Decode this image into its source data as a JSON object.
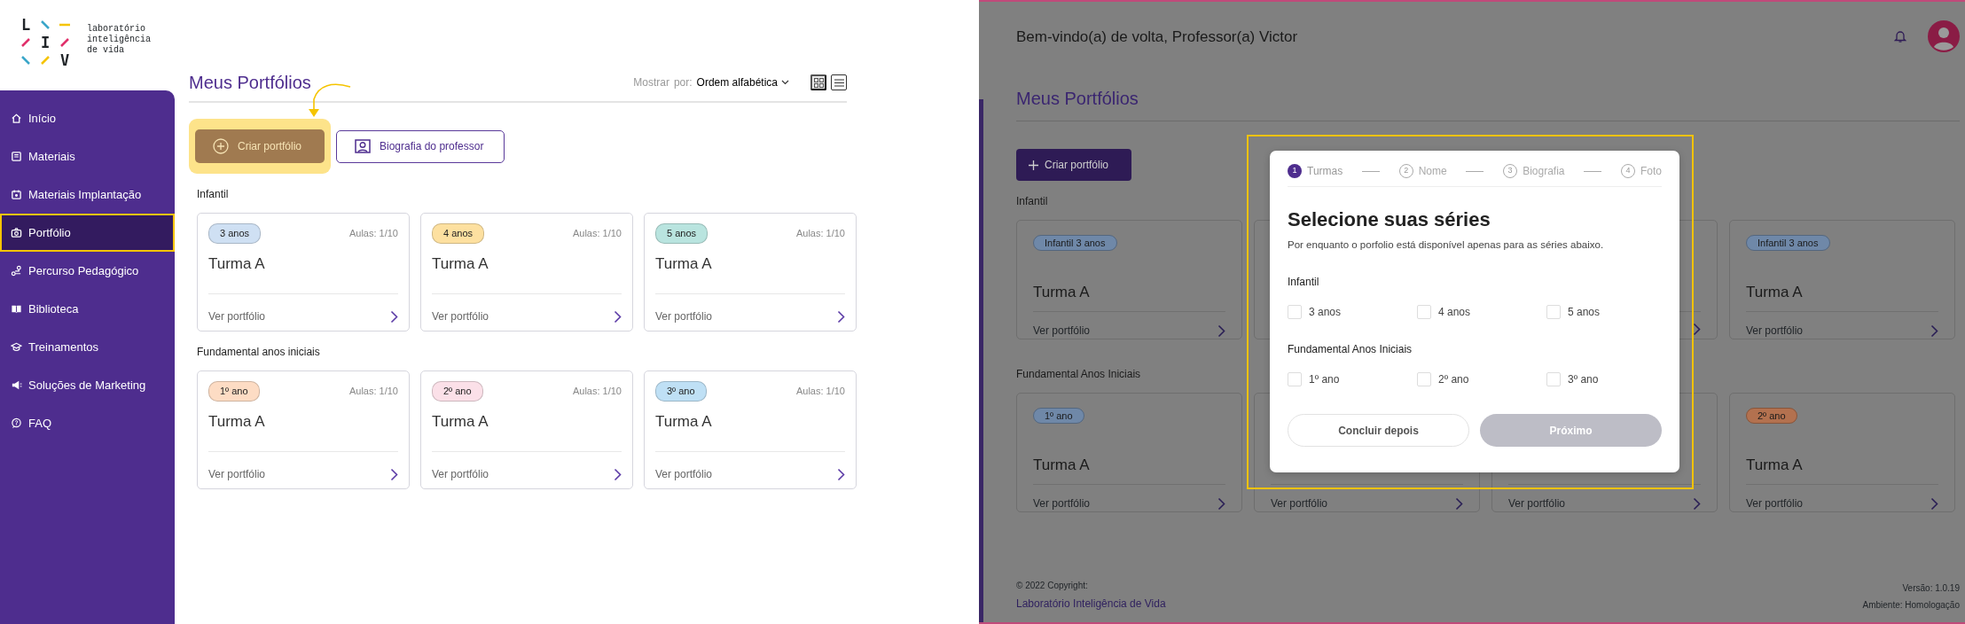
{
  "left_page": {
    "logo": {
      "letters": [
        "L",
        "I",
        "V"
      ],
      "tagline": [
        "laboratório",
        "inteligência",
        "de vida"
      ]
    },
    "sidebar": {
      "items": [
        {
          "label": "Início",
          "selected": false
        },
        {
          "label": "Materiais",
          "selected": false
        },
        {
          "label": "Materiais Implantação",
          "selected": false
        },
        {
          "label": "Portfólio",
          "selected": true
        },
        {
          "label": "Percurso Pedagógico",
          "selected": false
        },
        {
          "label": "Biblioteca",
          "selected": false
        },
        {
          "label": "Treinamentos",
          "selected": false
        },
        {
          "label": "Soluções de Marketing",
          "selected": false
        },
        {
          "label": "FAQ",
          "selected": false
        }
      ]
    },
    "header": {
      "title": "Meus Portfólios",
      "sort_label": "Mostrar",
      "sort_by": "por:",
      "sort_value": "Ordem alfabética",
      "view_modes": [
        {
          "kind": "grid",
          "selected": true
        },
        {
          "kind": "list",
          "selected": false
        }
      ]
    },
    "actions": [
      {
        "kind": "create",
        "label": "Criar portfólio",
        "highlighted": true
      },
      {
        "kind": "bio",
        "label": "Biografia do professor",
        "highlighted": false
      }
    ],
    "sections": [
      {
        "title": "Infantil",
        "cards": [
          {
            "badge": "3 anos",
            "color": "#cfe0f3",
            "lessons": "Aulas: 1/10",
            "title": "Turma A",
            "link": "Ver portfólio"
          },
          {
            "badge": "4 anos",
            "color": "#fde0a0",
            "lessons": "Aulas: 1/10",
            "title": "Turma A",
            "link": "Ver portfólio"
          },
          {
            "badge": "5 anos",
            "color": "#b9e4df",
            "lessons": "Aulas: 1/10",
            "title": "Turma A",
            "link": "Ver portfólio"
          }
        ]
      },
      {
        "title": "Fundamental anos iniciais",
        "cards": [
          {
            "badge": "1º ano",
            "color": "#fddcc4",
            "lessons": "Aulas: 1/10",
            "title": "Turma A",
            "link": "Ver portfólio"
          },
          {
            "badge": "2º ano",
            "color": "#fbe0e8",
            "lessons": "Aulas: 1/10",
            "title": "Turma A",
            "link": "Ver portfólio"
          },
          {
            "badge": "3º ano",
            "color": "#bfe0f5",
            "lessons": "Aulas: 1/10",
            "title": "Turma A",
            "link": "Ver portfólio"
          }
        ]
      }
    ]
  },
  "right_page": {
    "greeting": "Bem-vindo(a) de volta, Professor(a) Victor",
    "title": "Meus Portfólios",
    "create_button": "Criar portfólio",
    "sections": [
      {
        "title": "Infantil",
        "cards": [
          {
            "badge": "Infantil 3 anos",
            "color": "#6f88a8",
            "title": "Turma A",
            "link": "Ver portfólio",
            "chevron": true
          },
          {
            "chevron": false
          },
          {
            "chevron": true
          },
          {
            "badge": "Infantil 3 anos",
            "color": "#6f88a8",
            "title": "Turma A",
            "link": "Ver portfólio",
            "chevron": true
          }
        ]
      },
      {
        "title": "Fundamental Anos Iniciais",
        "cards": [
          {
            "badge": "1º ano",
            "color": "#6f88a8",
            "title": "Turma A",
            "link": "Ver portfólio",
            "chevron": true
          },
          {
            "link": "Ver portfólio",
            "chevron": true
          },
          {
            "link": "Ver portfólio",
            "chevron": true
          },
          {
            "badge": "2º ano",
            "color": "#b3714f",
            "title": "Turma A",
            "link": "Ver portfólio",
            "chevron": true
          }
        ]
      }
    ],
    "footer": {
      "copyright": "© 2022 Copyright:",
      "company": "Laboratório Inteligência de Vida",
      "version": "Versão: 1.0.19",
      "environment": "Ambiente: Homologação"
    },
    "modal": {
      "steps": [
        {
          "number": "1",
          "label": "Turmas",
          "selected": true
        },
        {
          "number": "2",
          "label": "Nome",
          "selected": false
        },
        {
          "number": "3",
          "label": "Biografia",
          "selected": false
        },
        {
          "number": "4",
          "label": "Foto",
          "selected": false
        }
      ],
      "title": "Selecione suas séries",
      "subtitle": "Por enquanto o porfolio está disponível apenas para as séries abaixo.",
      "groups": [
        {
          "title": "Infantil",
          "options": [
            {
              "label": "3 anos",
              "checked": false
            },
            {
              "label": "4 anos",
              "checked": false
            },
            {
              "label": "5 anos",
              "checked": false
            }
          ]
        },
        {
          "title": "Fundamental Anos Iniciais",
          "options": [
            {
              "label": "1º ano",
              "checked": false
            },
            {
              "label": "2º ano",
              "checked": false
            },
            {
              "label": "3º ano",
              "checked": false
            }
          ]
        }
      ],
      "buttons": [
        {
          "label": "Concluir depois",
          "disabled": false
        },
        {
          "label": "Próximo",
          "disabled": true
        }
      ]
    }
  }
}
